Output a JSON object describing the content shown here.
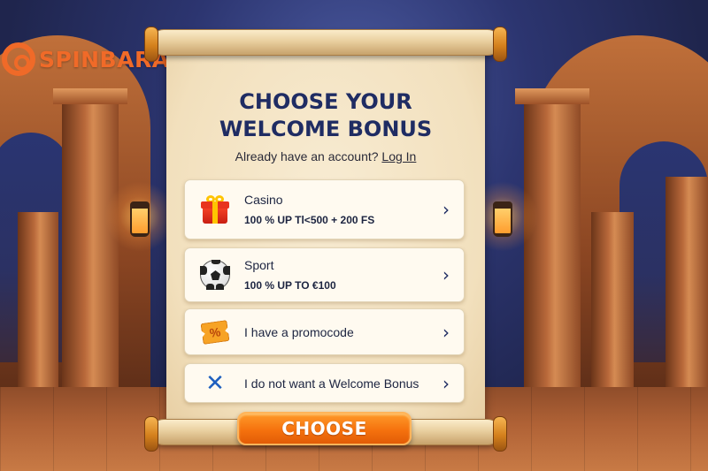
{
  "brand": {
    "name": "SPINBARA",
    "color": "#f06a28",
    "icon": "spiral-logo-icon"
  },
  "title": {
    "line1": "CHOOSE YOUR",
    "line2": "WELCOME BONUS"
  },
  "login": {
    "prompt": "Already have an account?",
    "link": "Log In"
  },
  "options": [
    {
      "name": "Casino",
      "detail": "100 % UP Tl<500 + 200 FS",
      "icon": "gift-icon"
    },
    {
      "name": "Sport",
      "detail": "100 % UP TO €100",
      "icon": "soccer-ball-icon"
    },
    {
      "name": "I have a promocode",
      "icon": "percent-ticket-icon",
      "glyph": "%"
    },
    {
      "name": "I do not want a Welcome Bonus",
      "icon": "x-icon",
      "glyph": "✕"
    }
  ],
  "chevron": "›",
  "cta": {
    "label": "CHOOSE",
    "color": "#f5720e"
  },
  "colors": {
    "title": "#1f2c63",
    "paper": "#f2e0bd",
    "card": "#fffaf0"
  }
}
